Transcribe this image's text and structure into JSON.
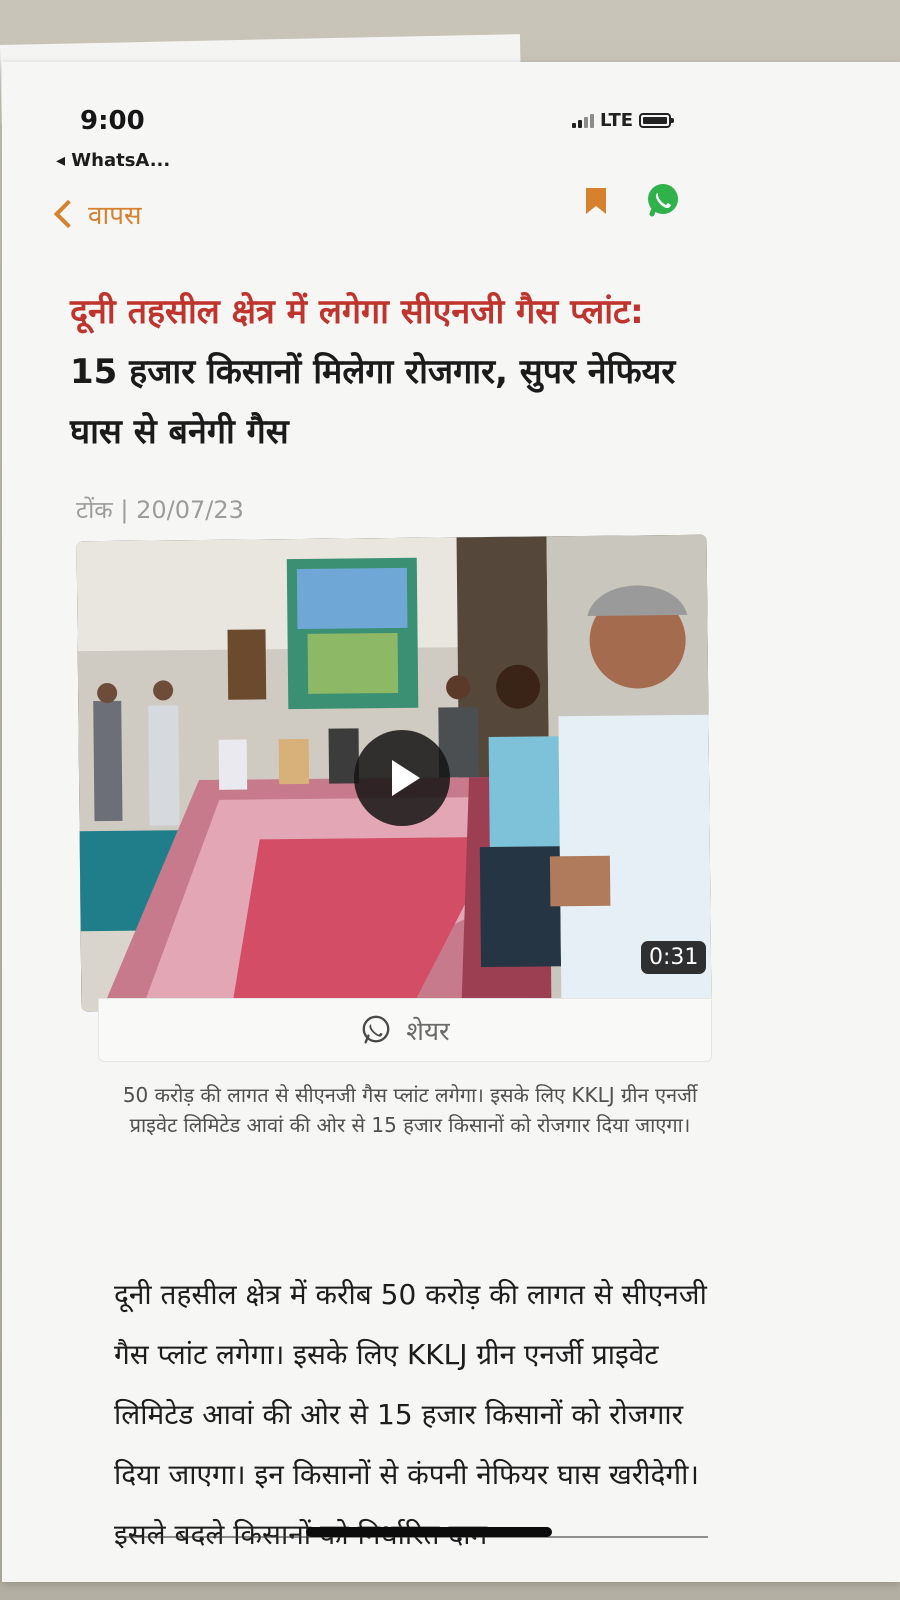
{
  "status_bar": {
    "time": "9:00",
    "back_app": "◂ WhatsA...",
    "network": "LTE"
  },
  "nav": {
    "back_label": "वापस",
    "bookmark_icon": "bookmark-icon",
    "whatsapp_icon": "whatsapp-icon"
  },
  "article": {
    "headline_red": "दूनी तहसील क्षेत्र में लगेगा सीएनजी गैस प्लांट:",
    "headline_black": " 15 हजार किसानों मिलेगा रोजगार, सुपर नेफियर घास से बनेगी गैस",
    "dateline": "टोंक | 20/07/23",
    "video": {
      "duration": "0:31",
      "share_label": "शेयर"
    },
    "caption": "50 करोड़ की लागत से सीएनजी गैस प्लांट लगेगा। इसके लिए KKLJ ग्रीन एनर्जी प्राइवेट लिमिटेड आवां की ओर से 15 हजार किसानों को रोजगार दिया जाएगा।",
    "body": "दूनी तहसील क्षेत्र में करीब 50 करोड़ की लागत से सीएनजी गैस प्लांट लगेगा। इसके लिए KKLJ ग्रीन एनर्जी प्राइवेट लिमिटेड आवां की ओर से 15 हजार किसानों को रोजगार दिया जाएगा। इन किसानों से कंपनी नेफियर घास खरीदेगी। इसले बदले किसानों को निर्धारित दाम"
  },
  "colors": {
    "accent_orange": "#d7812f",
    "headline_red": "#c0342e",
    "whatsapp_green": "#2fb24a"
  }
}
